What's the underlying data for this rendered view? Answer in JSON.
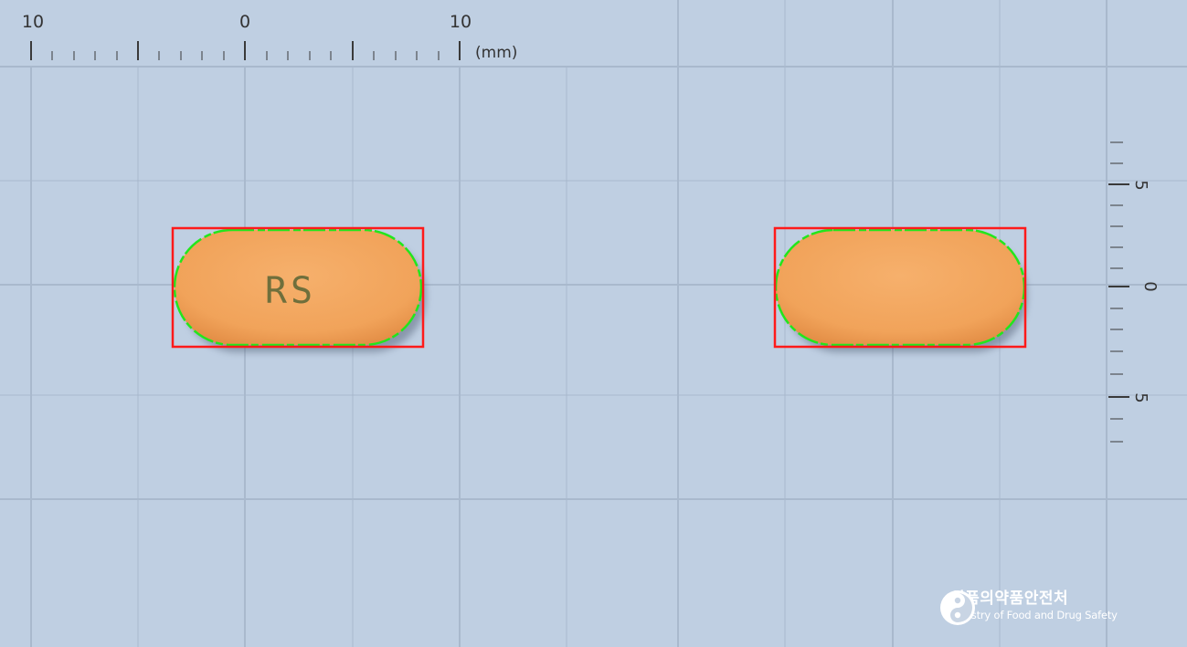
{
  "ruler_top": {
    "labels": [
      "10",
      "0",
      "10"
    ],
    "unit": "(mm)"
  },
  "ruler_right": {
    "labels": [
      "5",
      "0",
      "5"
    ]
  },
  "tablets": [
    {
      "name": "front",
      "imprint": "RS"
    },
    {
      "name": "back",
      "imprint": ""
    }
  ],
  "colors": {
    "background": "#bfcfe2",
    "grid_line": "#a7b8cc",
    "tablet_fill": "#f2a55d",
    "bounding_box": "#ff1a1a",
    "contour": "#22e61c",
    "imprint": "#6f6f3c"
  },
  "logo": {
    "emblem_icon": "government-emblem-icon",
    "korean": "식품의약품안전처",
    "english": "Ministry of Food and Drug Safety"
  }
}
